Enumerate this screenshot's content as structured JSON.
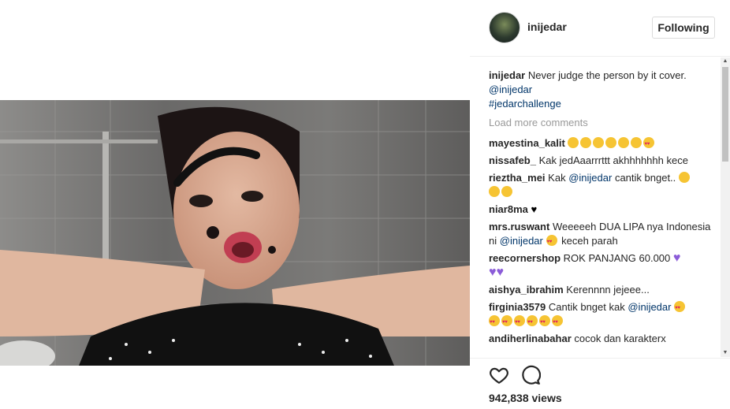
{
  "post": {
    "views_count": "942,838",
    "views_suffix": "views"
  },
  "header": {
    "username": "inijedar",
    "follow_label": "Following"
  },
  "caption": {
    "username": "inijedar",
    "text": "Never judge the person by it cover.",
    "mention": "@inijedar",
    "hashtag": "#jedarchallenge"
  },
  "load_more": "Load more comments",
  "comments": [
    {
      "user": "mayestina_kalit",
      "text": ""
    },
    {
      "user": "nissafeb_",
      "text": "Kak jedAaarrrttt akhhhhhhh kece"
    },
    {
      "user": "rieztha_mei",
      "text_before": "Kak",
      "mention": "@inijedar",
      "text_after": "cantik bnget.."
    },
    {
      "user": "niar8ma",
      "text": ""
    },
    {
      "user": "mrs.ruswant",
      "text_before": "Weeeeeh DUA LIPA nya Indonesia ni",
      "mention": "@inijedar",
      "text_after": "keceh parah"
    },
    {
      "user": "reecornershop",
      "text": "ROK PANJANG 60.000"
    },
    {
      "user": "aishya_ibrahim",
      "text": "Kerennnn jejeee..."
    },
    {
      "user": "firginia3579",
      "text_before": "Cantik bnget kak",
      "mention": "@inijedar",
      "text_after": ""
    },
    {
      "user": "andiherlinabahar",
      "text": "cocok dan karakterx"
    }
  ],
  "icons": {
    "like": "heart-outline-icon",
    "comment": "speech-bubble-icon"
  },
  "colors": {
    "link": "#003569",
    "muted": "#999999",
    "text": "#262626",
    "border": "#dbdbdb"
  }
}
